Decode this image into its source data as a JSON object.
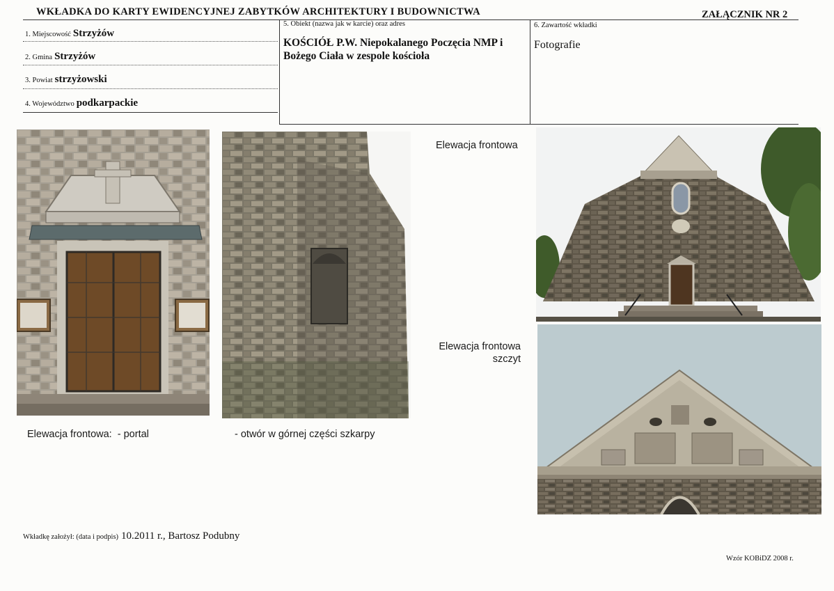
{
  "header": {
    "title": "WKŁADKA DO KARTY EWIDENCYJNEJ ZABYTKÓW ARCHITEKTURY I BUDOWNICTWA",
    "attachment": "ZAŁĄCZNIK NR 2"
  },
  "location": {
    "town_label": "1. Miejscowość",
    "town_value": "Strzyżów",
    "commune_label": "2. Gmina",
    "commune_value": "Strzyżów",
    "county_label": "3. Powiat",
    "county_value": "strzyżowski",
    "voivodeship_label": "4. Województwo",
    "voivodeship_value": "podkarpackie"
  },
  "object": {
    "label": "5. Obiekt (nazwa jak w karcie) oraz adres",
    "name": "KOŚCIÓŁ P.W. Niepokalanego Poczęcia NMP i Bożego Ciała w zespole kościoła"
  },
  "contents": {
    "label": "6. Zawartość wkładki",
    "value": "Fotografie"
  },
  "captions": {
    "portal": "Elewacja frontowa:  - portal",
    "buttress": "- otwór w górnej części szkarpy",
    "front": "Elewacja frontowa",
    "gable_line1": "Elewacja frontowa",
    "gable_line2": "szczyt"
  },
  "footer": {
    "author_label": "Wkładkę założył: (data i podpis)",
    "author_value": "10.2011 r., Bartosz Podubny",
    "template": "Wzór KOBiDZ 2008 r."
  },
  "photos": {
    "portal": "photo-portal",
    "buttress": "photo-buttress",
    "front": "photo-front-elevation",
    "gable": "photo-gable"
  }
}
